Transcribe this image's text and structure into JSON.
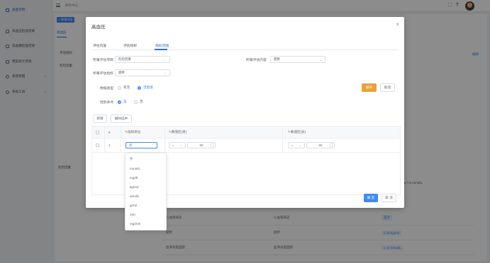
{
  "sidebar": {
    "items": [
      {
        "label": "质量控制"
      },
      {
        "label": "高血压检查结果"
      },
      {
        "label": "高血糖检查结果"
      },
      {
        "label": "模型统计结果"
      },
      {
        "label": "系统管理"
      },
      {
        "label": "系统工具"
      }
    ]
  },
  "topbar": {
    "breadcrumb": "质控中心"
  },
  "background": {
    "add_button": "+ 新增字段",
    "tab": "高血压",
    "label_indicator": "评估指标",
    "label_scope": "危险因素",
    "edit_link": "编辑",
    "rows": [
      {
        "c1": "心血管病史",
        "c2": "心血管病史",
        "tag": "是否"
      },
      {
        "c1": "肥胖",
        "c2": "肥胖",
        "tag": "≥ 28 kg/m2"
      },
      {
        "c1": "血清总胆固醇",
        "c2": "血清总胆固醇",
        "tag": "≥ 10 mmol/L"
      }
    ],
    "side_value": "≥ 7.0 mmol/L"
  },
  "dialog": {
    "title": "高血压",
    "tabs": [
      "评估内容",
      "评估指标",
      "指标范围"
    ],
    "active_tab_index": 2,
    "form": {
      "project_label": "所属评估项目",
      "project_value": "危险因素",
      "content_label": "所属评估内容",
      "content_value": "肥胖",
      "indicator_label": "所属评估指标",
      "indicator_value": "肥胖",
      "data_type_label": "数据类型",
      "data_type_options": [
        "有无",
        "范围值"
      ],
      "data_type_selected": "范围值",
      "gender_label": "性别条件",
      "gender_options": [
        "是",
        "否"
      ],
      "gender_selected": "是"
    },
    "buttons": {
      "save": "保存",
      "cancel": "取消",
      "add": "新增",
      "delete_selected": "删除选中",
      "confirm": "确 定",
      "cancel_footer": "取 消"
    },
    "table": {
      "headers": [
        "#",
        "指标单位",
        "数值区(男)",
        "数值区(女)"
      ],
      "rows": [
        {
          "index": "1",
          "unit": "岁",
          "male_op": "=",
          "male_value": "60",
          "female_op": "=",
          "female_value": "60"
        }
      ]
    },
    "unit_dropdown": {
      "options": [
        "岁",
        "mmol/L",
        "mg/dl",
        "kg/m2",
        "umol/L",
        "g/m2",
        "mm",
        "mg/24h"
      ],
      "selected": "岁"
    }
  }
}
